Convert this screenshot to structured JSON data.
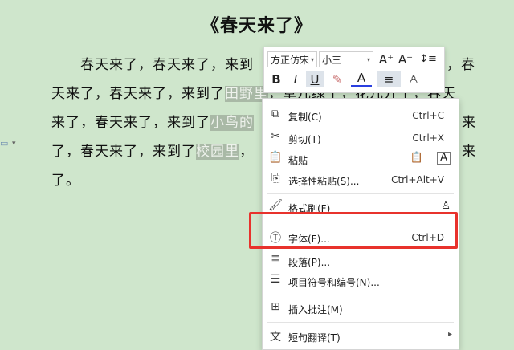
{
  "document": {
    "title": "《春天来了》",
    "lines": [
      {
        "segs": [
          {
            "t": "　　春天来了，春天来了，来到",
            "h": false
          },
          {
            "t": "",
            "h": false
          }
        ]
      },
      {
        "segs": [
          {
            "t": "天来了，春天来了，来到了",
            "h": false
          },
          {
            "t": "田野里",
            "h": true
          },
          {
            "t": "，草儿绿了，花儿开了，春天",
            "h": false
          }
        ]
      },
      {
        "segs": [
          {
            "t": "来了，春天来了，来到了",
            "h": false
          },
          {
            "t": "小鸟的",
            "h": true
          }
        ]
      },
      {
        "segs": [
          {
            "t": "了，春天来了，来到了",
            "h": false
          },
          {
            "t": "校园里",
            "h": true
          },
          {
            "t": "，",
            "h": false
          }
        ]
      },
      {
        "segs": [
          {
            "t": "了。",
            "h": false
          }
        ]
      }
    ],
    "right_tail": {
      "l1": "，春",
      "l3": "来",
      "l4": "来"
    }
  },
  "mini_toolbar": {
    "font_name": "方正仿宋",
    "font_size": "小三",
    "grow_font": "A⁺",
    "shrink_font": "A⁻",
    "line_spacing": "↕≡",
    "bold": "B",
    "italic": "I",
    "underline": "U",
    "highlight": "✎",
    "font_color": "A",
    "align": "≡",
    "format_painter": "♙"
  },
  "context_menu": {
    "items": [
      {
        "icon": "copy-icon",
        "glyph": "⧉",
        "label": "复制(C)",
        "shortcut": "Ctrl+C"
      },
      {
        "icon": "cut-icon",
        "glyph": "✂",
        "label": "剪切(T)",
        "shortcut": "Ctrl+X"
      },
      {
        "icon": "paste-icon",
        "glyph": "📋",
        "label": "粘贴",
        "shortcut": ""
      },
      {
        "icon": "paste-special-icon",
        "glyph": "⎘",
        "label": "选择性粘贴(S)...",
        "shortcut": "Ctrl+Alt+V"
      },
      {
        "icon": "format-brush-icon",
        "glyph": "🖌",
        "label": "格式刷(F)",
        "shortcut": ""
      },
      {
        "icon": "font-icon",
        "glyph": "Ⓣ",
        "label": "字体(F)...",
        "shortcut": "Ctrl+D"
      },
      {
        "icon": "paragraph-icon",
        "glyph": "≣",
        "label": "段落(P)...",
        "shortcut": ""
      },
      {
        "icon": "bullets-icon",
        "glyph": "☰",
        "label": "项目符号和编号(N)...",
        "shortcut": ""
      },
      {
        "icon": "insert-comment-icon",
        "glyph": "⊞",
        "label": "插入批注(M)",
        "shortcut": ""
      },
      {
        "icon": "translate-icon",
        "glyph": "文",
        "label": "短句翻译(T)",
        "shortcut": ""
      }
    ],
    "paste_options": [
      "📋",
      "A"
    ]
  },
  "colors": {
    "background": "#cfe6cc",
    "highlight_box": "#e8322c",
    "font_color_bar": "#2a3fe0"
  }
}
